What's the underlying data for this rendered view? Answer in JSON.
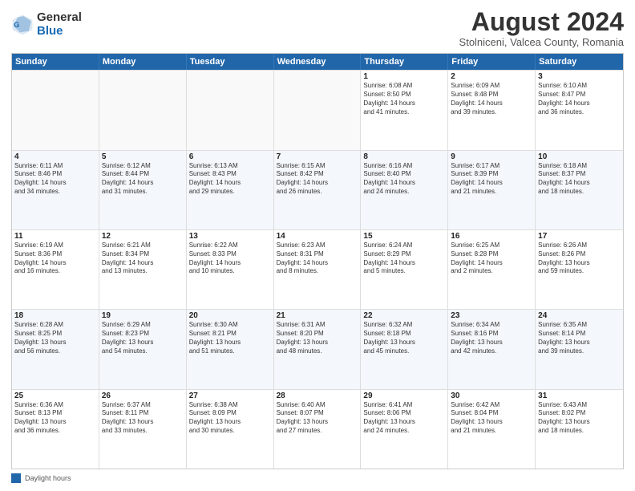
{
  "logo": {
    "general": "General",
    "blue": "Blue"
  },
  "title": "August 2024",
  "subtitle": "Stolniceni, Valcea County, Romania",
  "header_days": [
    "Sunday",
    "Monday",
    "Tuesday",
    "Wednesday",
    "Thursday",
    "Friday",
    "Saturday"
  ],
  "footer": {
    "legend_label": "Daylight hours"
  },
  "rows": [
    {
      "cells": [
        {
          "day": "",
          "text": ""
        },
        {
          "day": "",
          "text": ""
        },
        {
          "day": "",
          "text": ""
        },
        {
          "day": "",
          "text": ""
        },
        {
          "day": "1",
          "text": "Sunrise: 6:08 AM\nSunset: 8:50 PM\nDaylight: 14 hours\nand 41 minutes."
        },
        {
          "day": "2",
          "text": "Sunrise: 6:09 AM\nSunset: 8:48 PM\nDaylight: 14 hours\nand 39 minutes."
        },
        {
          "day": "3",
          "text": "Sunrise: 6:10 AM\nSunset: 8:47 PM\nDaylight: 14 hours\nand 36 minutes."
        }
      ]
    },
    {
      "cells": [
        {
          "day": "4",
          "text": "Sunrise: 6:11 AM\nSunset: 8:46 PM\nDaylight: 14 hours\nand 34 minutes."
        },
        {
          "day": "5",
          "text": "Sunrise: 6:12 AM\nSunset: 8:44 PM\nDaylight: 14 hours\nand 31 minutes."
        },
        {
          "day": "6",
          "text": "Sunrise: 6:13 AM\nSunset: 8:43 PM\nDaylight: 14 hours\nand 29 minutes."
        },
        {
          "day": "7",
          "text": "Sunrise: 6:15 AM\nSunset: 8:42 PM\nDaylight: 14 hours\nand 26 minutes."
        },
        {
          "day": "8",
          "text": "Sunrise: 6:16 AM\nSunset: 8:40 PM\nDaylight: 14 hours\nand 24 minutes."
        },
        {
          "day": "9",
          "text": "Sunrise: 6:17 AM\nSunset: 8:39 PM\nDaylight: 14 hours\nand 21 minutes."
        },
        {
          "day": "10",
          "text": "Sunrise: 6:18 AM\nSunset: 8:37 PM\nDaylight: 14 hours\nand 18 minutes."
        }
      ]
    },
    {
      "cells": [
        {
          "day": "11",
          "text": "Sunrise: 6:19 AM\nSunset: 8:36 PM\nDaylight: 14 hours\nand 16 minutes."
        },
        {
          "day": "12",
          "text": "Sunrise: 6:21 AM\nSunset: 8:34 PM\nDaylight: 14 hours\nand 13 minutes."
        },
        {
          "day": "13",
          "text": "Sunrise: 6:22 AM\nSunset: 8:33 PM\nDaylight: 14 hours\nand 10 minutes."
        },
        {
          "day": "14",
          "text": "Sunrise: 6:23 AM\nSunset: 8:31 PM\nDaylight: 14 hours\nand 8 minutes."
        },
        {
          "day": "15",
          "text": "Sunrise: 6:24 AM\nSunset: 8:29 PM\nDaylight: 14 hours\nand 5 minutes."
        },
        {
          "day": "16",
          "text": "Sunrise: 6:25 AM\nSunset: 8:28 PM\nDaylight: 14 hours\nand 2 minutes."
        },
        {
          "day": "17",
          "text": "Sunrise: 6:26 AM\nSunset: 8:26 PM\nDaylight: 13 hours\nand 59 minutes."
        }
      ]
    },
    {
      "cells": [
        {
          "day": "18",
          "text": "Sunrise: 6:28 AM\nSunset: 8:25 PM\nDaylight: 13 hours\nand 56 minutes."
        },
        {
          "day": "19",
          "text": "Sunrise: 6:29 AM\nSunset: 8:23 PM\nDaylight: 13 hours\nand 54 minutes."
        },
        {
          "day": "20",
          "text": "Sunrise: 6:30 AM\nSunset: 8:21 PM\nDaylight: 13 hours\nand 51 minutes."
        },
        {
          "day": "21",
          "text": "Sunrise: 6:31 AM\nSunset: 8:20 PM\nDaylight: 13 hours\nand 48 minutes."
        },
        {
          "day": "22",
          "text": "Sunrise: 6:32 AM\nSunset: 8:18 PM\nDaylight: 13 hours\nand 45 minutes."
        },
        {
          "day": "23",
          "text": "Sunrise: 6:34 AM\nSunset: 8:16 PM\nDaylight: 13 hours\nand 42 minutes."
        },
        {
          "day": "24",
          "text": "Sunrise: 6:35 AM\nSunset: 8:14 PM\nDaylight: 13 hours\nand 39 minutes."
        }
      ]
    },
    {
      "cells": [
        {
          "day": "25",
          "text": "Sunrise: 6:36 AM\nSunset: 8:13 PM\nDaylight: 13 hours\nand 36 minutes."
        },
        {
          "day": "26",
          "text": "Sunrise: 6:37 AM\nSunset: 8:11 PM\nDaylight: 13 hours\nand 33 minutes."
        },
        {
          "day": "27",
          "text": "Sunrise: 6:38 AM\nSunset: 8:09 PM\nDaylight: 13 hours\nand 30 minutes."
        },
        {
          "day": "28",
          "text": "Sunrise: 6:40 AM\nSunset: 8:07 PM\nDaylight: 13 hours\nand 27 minutes."
        },
        {
          "day": "29",
          "text": "Sunrise: 6:41 AM\nSunset: 8:06 PM\nDaylight: 13 hours\nand 24 minutes."
        },
        {
          "day": "30",
          "text": "Sunrise: 6:42 AM\nSunset: 8:04 PM\nDaylight: 13 hours\nand 21 minutes."
        },
        {
          "day": "31",
          "text": "Sunrise: 6:43 AM\nSunset: 8:02 PM\nDaylight: 13 hours\nand 18 minutes."
        }
      ]
    }
  ]
}
